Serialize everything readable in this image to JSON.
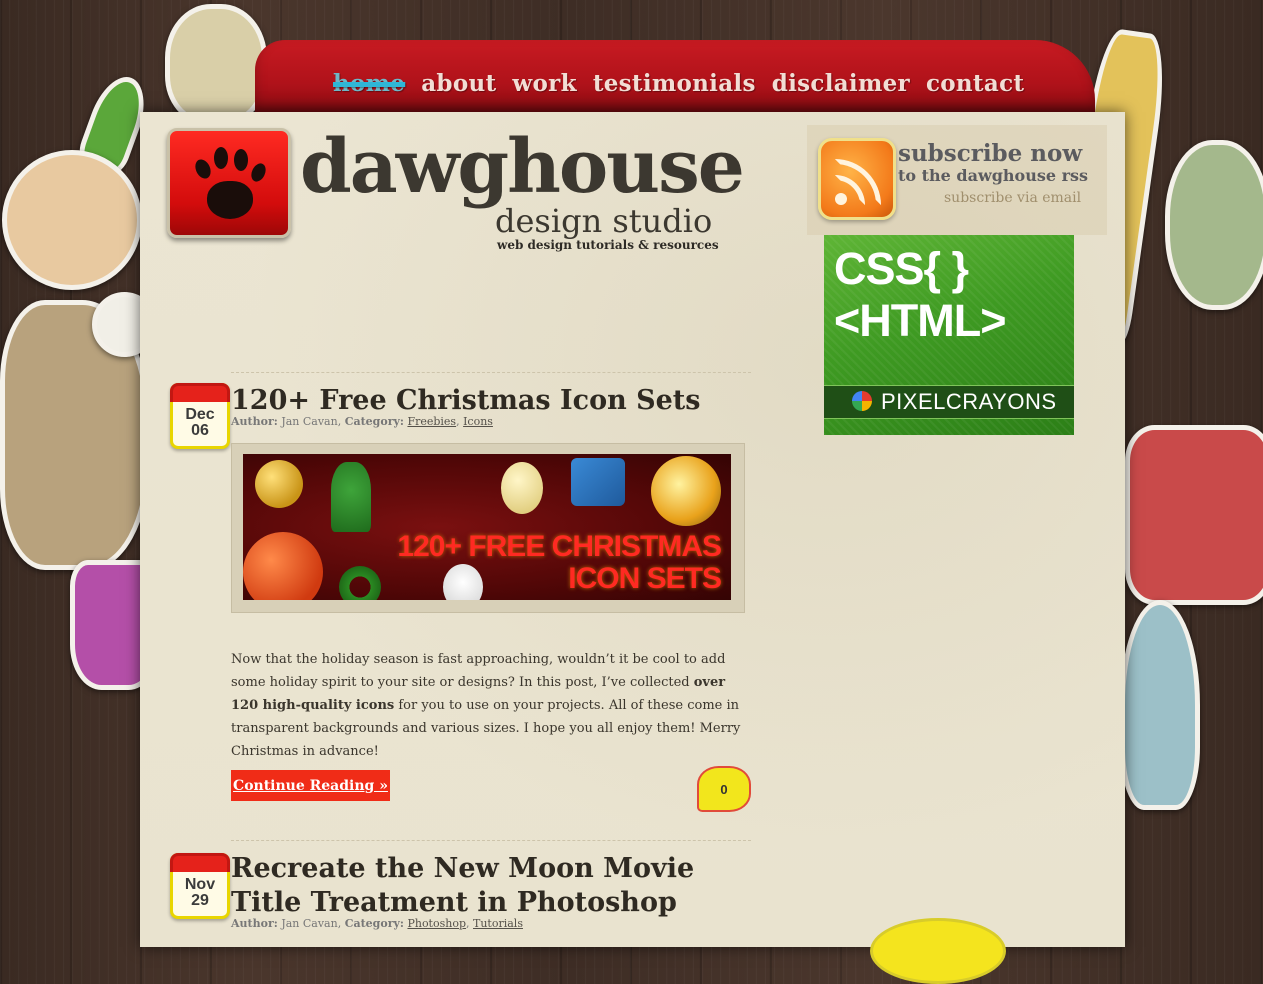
{
  "nav": {
    "items": [
      {
        "label": "home",
        "current": true
      },
      {
        "label": "about",
        "current": false
      },
      {
        "label": "work",
        "current": false
      },
      {
        "label": "testimonials",
        "current": false
      },
      {
        "label": "disclaimer",
        "current": false
      },
      {
        "label": "contact",
        "current": false
      }
    ]
  },
  "brand": {
    "name": "dawghouse",
    "sub": "design studio",
    "tagline": "web design tutorials & resources"
  },
  "subscribe": {
    "title": "subscribe now",
    "line": "to the dawghouse rss",
    "email_link": "subscribe via email"
  },
  "ad": {
    "line1": "CSS{ }",
    "line2": "<HTML>",
    "brand": "PIXELCRAYONS"
  },
  "posts": [
    {
      "month": "Dec",
      "day": "06",
      "title": "120+ Free Christmas Icon Sets",
      "author_label": "Author:",
      "author": "Jan Cavan,",
      "category_label": "Category:",
      "categories": [
        "Freebies",
        "Icons"
      ],
      "thumb_text_1": "120+ FREE CHRISTMAS",
      "thumb_text_2": "ICON SETS",
      "excerpt_1": "Now that the holiday season is fast approaching, wouldn’t it be cool to add some holiday spirit to your site or designs? In this post, I’ve collected ",
      "excerpt_bold": "over 120 high-quality icons",
      "excerpt_2": " for you to use on your projects. All of these come in transparent backgrounds and various sizes. I hope you all enjoy them! Merry Christmas in advance!",
      "continue_label": "Continue Reading »",
      "comments": "0"
    },
    {
      "month": "Nov",
      "day": "29",
      "title": "Recreate the New Moon Movie Title Treatment in Photoshop",
      "author_label": "Author:",
      "author": "Jan Cavan,",
      "category_label": "Category:",
      "categories": [
        "Photoshop",
        "Tutorials"
      ]
    }
  ],
  "colors": {
    "nav_red": "#c81b22",
    "accent_red": "#f02c17",
    "paper": "#ebe5d2",
    "ad_green": "#3e9a22"
  }
}
